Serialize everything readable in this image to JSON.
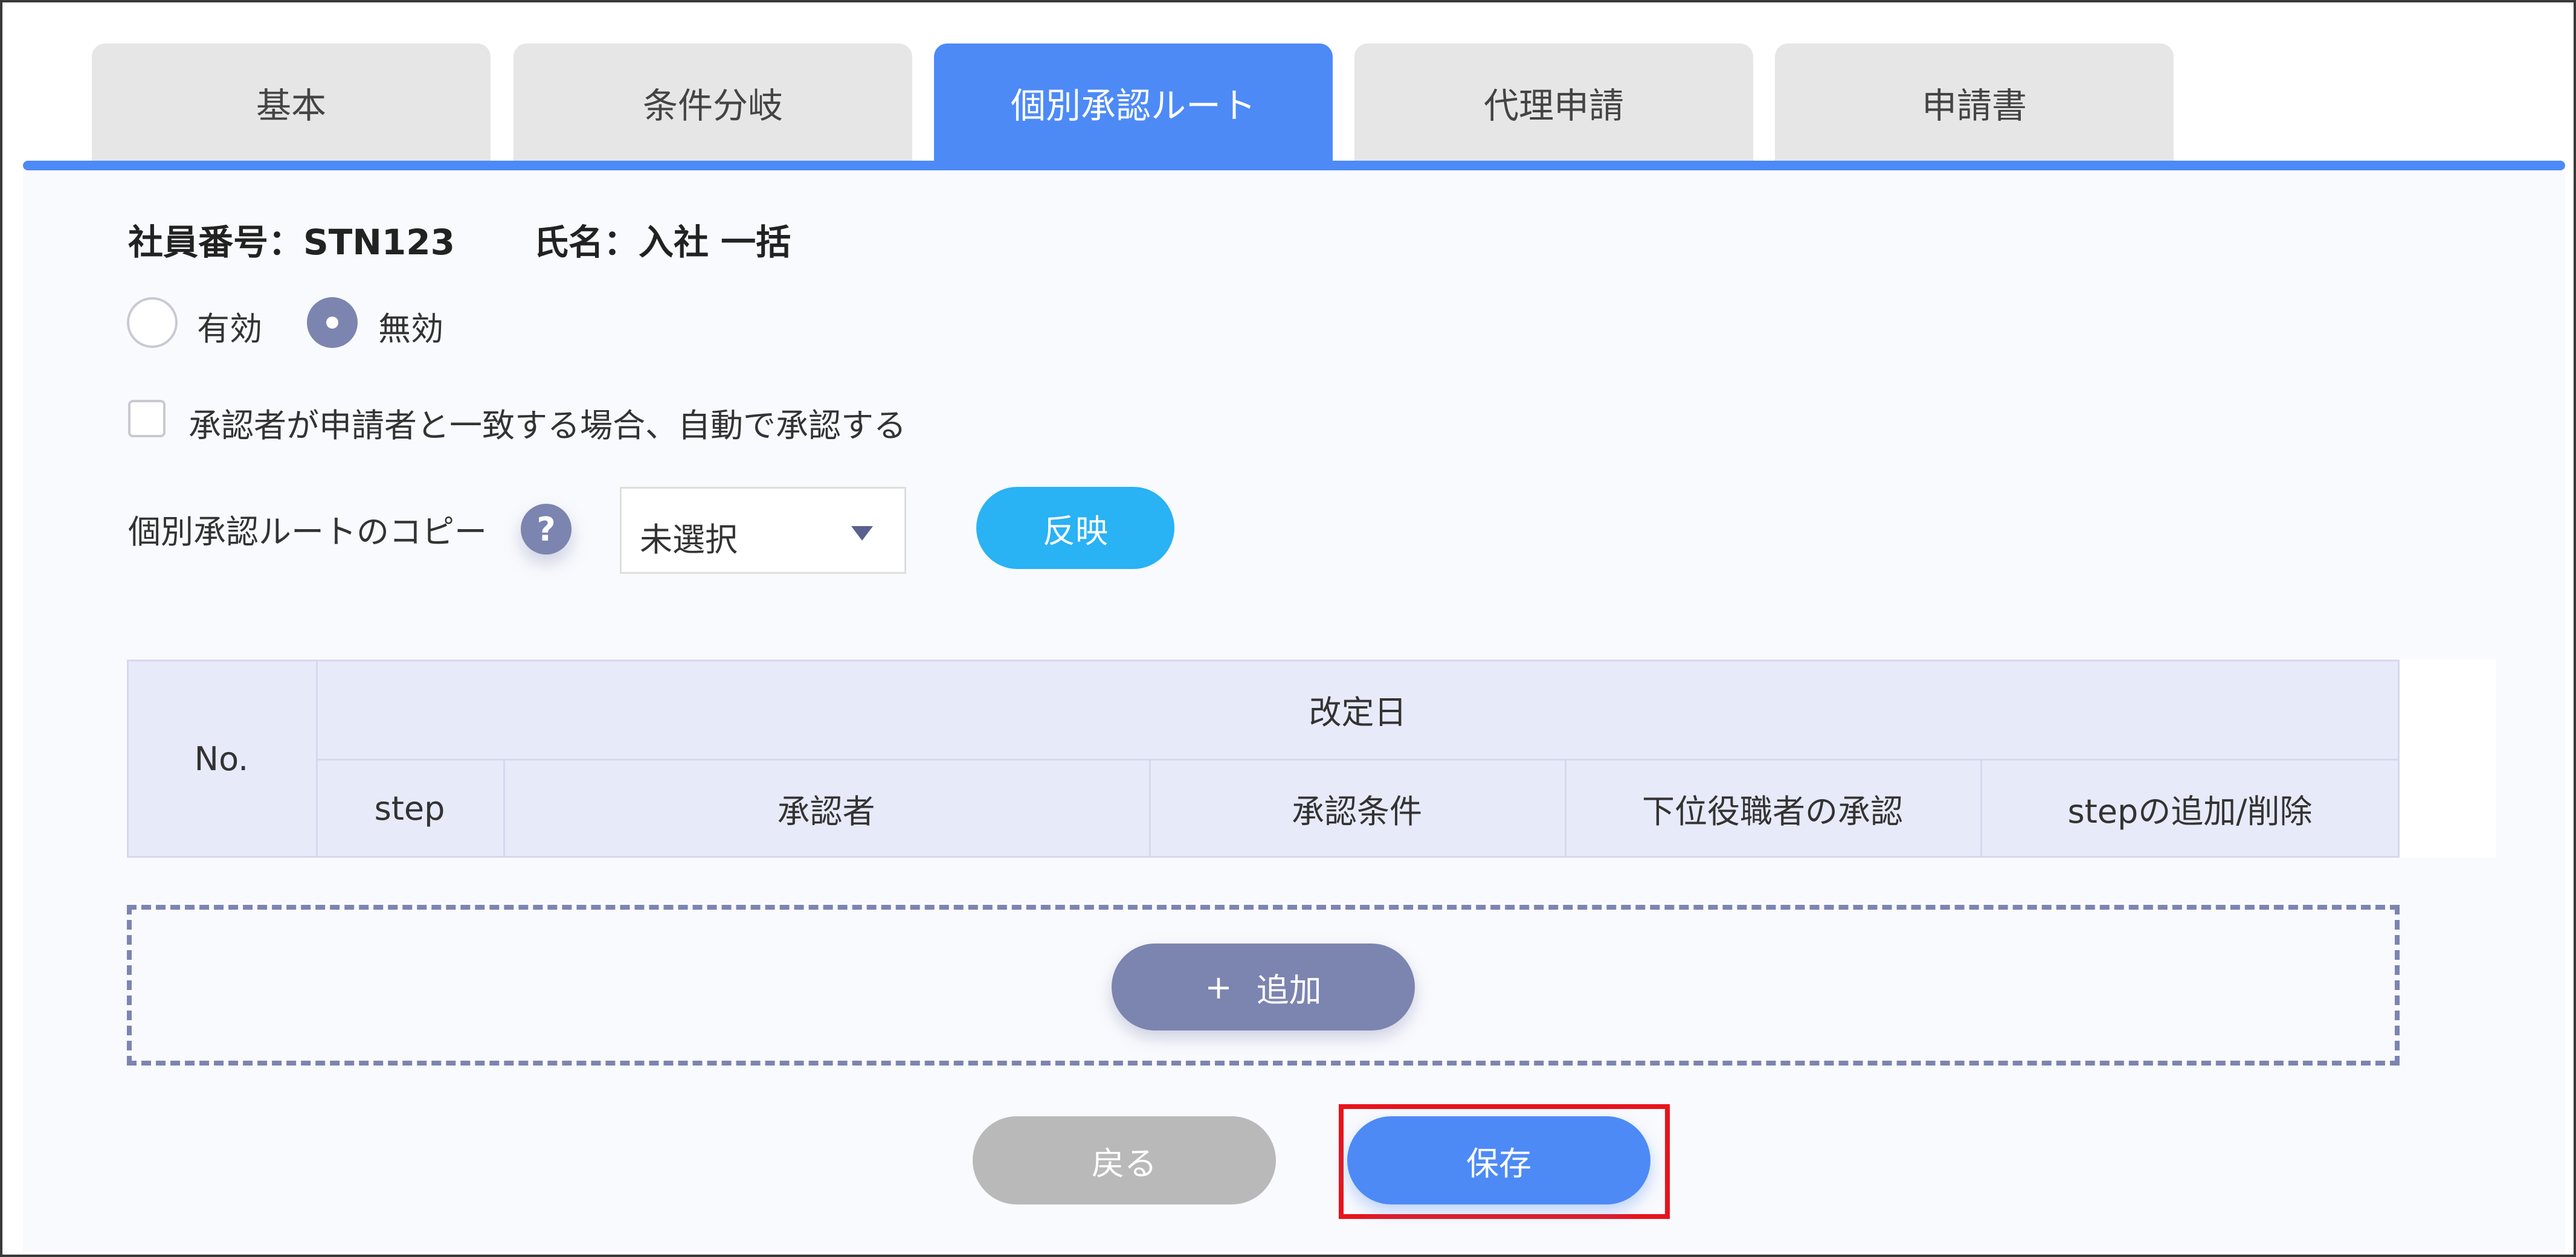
{
  "tabs": [
    {
      "label": "基本",
      "active": false
    },
    {
      "label": "条件分岐",
      "active": false
    },
    {
      "label": "個別承認ルート",
      "active": true
    },
    {
      "label": "代理申請",
      "active": false
    },
    {
      "label": "申請書",
      "active": false
    }
  ],
  "employee": {
    "number_text": "社員番号：STN123",
    "name_text": "氏名：入社 一括"
  },
  "status_radio": {
    "options": [
      "有効",
      "無効"
    ],
    "selected": "無効"
  },
  "auto_approve": {
    "label": "承認者が申請者と一致する場合、自動で承認する",
    "checked": false
  },
  "copy_route": {
    "label": "個別承認ルートのコピー",
    "help_icon": "?",
    "select_value": "未選択",
    "reflect_label": "反映"
  },
  "table": {
    "no_header": "No.",
    "date_header": "改定日",
    "sub_headers": [
      "step",
      "承認者",
      "承認条件",
      "下位役職者の承認",
      "stepの追加/削除"
    ]
  },
  "add_button": {
    "icon": "+",
    "label": "追加"
  },
  "footer": {
    "back_label": "戻る",
    "save_label": "保存"
  },
  "colors": {
    "accent": "#4d8af6",
    "reflect": "#29b2f4",
    "secondary": "#7c84b0",
    "highlight": "#e8141c",
    "back": "#b9b9b9"
  }
}
